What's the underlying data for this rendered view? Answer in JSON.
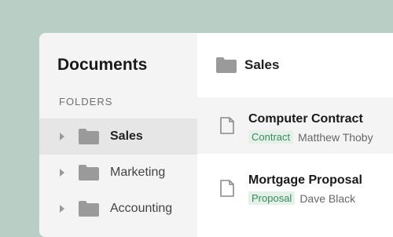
{
  "sidebar": {
    "title": "Documents",
    "section_label": "FOLDERS",
    "items": [
      {
        "label": "Sales",
        "active": true
      },
      {
        "label": "Marketing",
        "active": false
      },
      {
        "label": "Accounting",
        "active": false
      }
    ]
  },
  "main": {
    "title": "Sales",
    "documents": [
      {
        "title": "Computer Contract",
        "tag": "Contract",
        "owner": "Matthew Thoby"
      },
      {
        "title": "Mortgage Proposal",
        "tag": "Proposal",
        "owner": "Dave Black"
      }
    ]
  },
  "colors": {
    "background": "#b9cfc6",
    "tag_bg": "#e3f1e8",
    "tag_text": "#3a8a5a",
    "active_row": "#e6e6e6"
  }
}
